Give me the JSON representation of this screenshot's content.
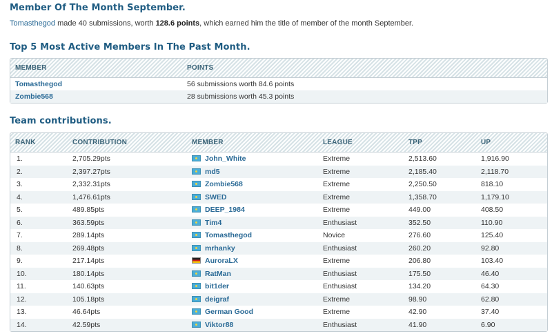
{
  "motm": {
    "title": "Member Of The Month September.",
    "member": "Tomasthegod",
    "text1": " made 40 submissions, worth ",
    "points": "128.6 points",
    "text2": ", which earned him the title of member of the month September."
  },
  "top5": {
    "title": "Top 5 Most Active Members In The Past Month.",
    "headers": {
      "member": "MEMBER",
      "points": "POINTS"
    },
    "rows": [
      {
        "member": "Tomasthegod",
        "points": "56 submissions worth 84.6 points"
      },
      {
        "member": "Zombie568",
        "points": "28 submissions worth 45.3 points"
      }
    ]
  },
  "team": {
    "title": "Team contributions.",
    "headers": {
      "rank": "RANK",
      "contribution": "CONTRIBUTION",
      "member": "MEMBER",
      "league": "LEAGUE",
      "tpp": "TPP",
      "up": "UP"
    },
    "rows": [
      {
        "rank": "1.",
        "contribution": "2,705.29pts",
        "flag": "kz",
        "member": "John_White",
        "league": "Extreme",
        "tpp": "2,513.60",
        "up": "1,916.90"
      },
      {
        "rank": "2.",
        "contribution": "2,397.27pts",
        "flag": "kz",
        "member": "md5",
        "league": "Extreme",
        "tpp": "2,185.40",
        "up": "2,118.70"
      },
      {
        "rank": "3.",
        "contribution": "2,332.31pts",
        "flag": "kz",
        "member": "Zombie568",
        "league": "Extreme",
        "tpp": "2,250.50",
        "up": "818.10"
      },
      {
        "rank": "4.",
        "contribution": "1,476.61pts",
        "flag": "kz",
        "member": "SWED",
        "league": "Extreme",
        "tpp": "1,358.70",
        "up": "1,179.10"
      },
      {
        "rank": "5.",
        "contribution": "489.85pts",
        "flag": "kz",
        "member": "DEEP_1984",
        "league": "Extreme",
        "tpp": "449.00",
        "up": "408.50"
      },
      {
        "rank": "6.",
        "contribution": "363.59pts",
        "flag": "kz",
        "member": "Tim4",
        "league": "Enthusiast",
        "tpp": "352.50",
        "up": "110.90"
      },
      {
        "rank": "7.",
        "contribution": "289.14pts",
        "flag": "kz",
        "member": "Tomasthegod",
        "league": "Novice",
        "tpp": "276.60",
        "up": "125.40"
      },
      {
        "rank": "8.",
        "contribution": "269.48pts",
        "flag": "kz",
        "member": "mrhanky",
        "league": "Enthusiast",
        "tpp": "260.20",
        "up": "92.80"
      },
      {
        "rank": "9.",
        "contribution": "217.14pts",
        "flag": "de",
        "member": "AuroraLX",
        "league": "Extreme",
        "tpp": "206.80",
        "up": "103.40"
      },
      {
        "rank": "10.",
        "contribution": "180.14pts",
        "flag": "kz",
        "member": "RatMan",
        "league": "Enthusiast",
        "tpp": "175.50",
        "up": "46.40"
      },
      {
        "rank": "11.",
        "contribution": "140.63pts",
        "flag": "kz",
        "member": "bit1der",
        "league": "Enthusiast",
        "tpp": "134.20",
        "up": "64.30"
      },
      {
        "rank": "12.",
        "contribution": "105.18pts",
        "flag": "kz",
        "member": "deigraf",
        "league": "Extreme",
        "tpp": "98.90",
        "up": "62.80"
      },
      {
        "rank": "13.",
        "contribution": "46.64pts",
        "flag": "kz",
        "member": "German Good",
        "league": "Extreme",
        "tpp": "42.90",
        "up": "37.40"
      },
      {
        "rank": "14.",
        "contribution": "42.59pts",
        "flag": "kz",
        "member": "Viktor88",
        "league": "Enthusiast",
        "tpp": "41.90",
        "up": "6.90"
      }
    ]
  },
  "icons": {
    "flag_kz": "flag-kz-icon",
    "flag_de": "flag-de-icon"
  },
  "colors": {
    "heading": "#1f5c82",
    "link": "#2a6a96",
    "header_text": "#3b6478",
    "alt_row": "#eef3f5",
    "border": "#c4ced4"
  }
}
